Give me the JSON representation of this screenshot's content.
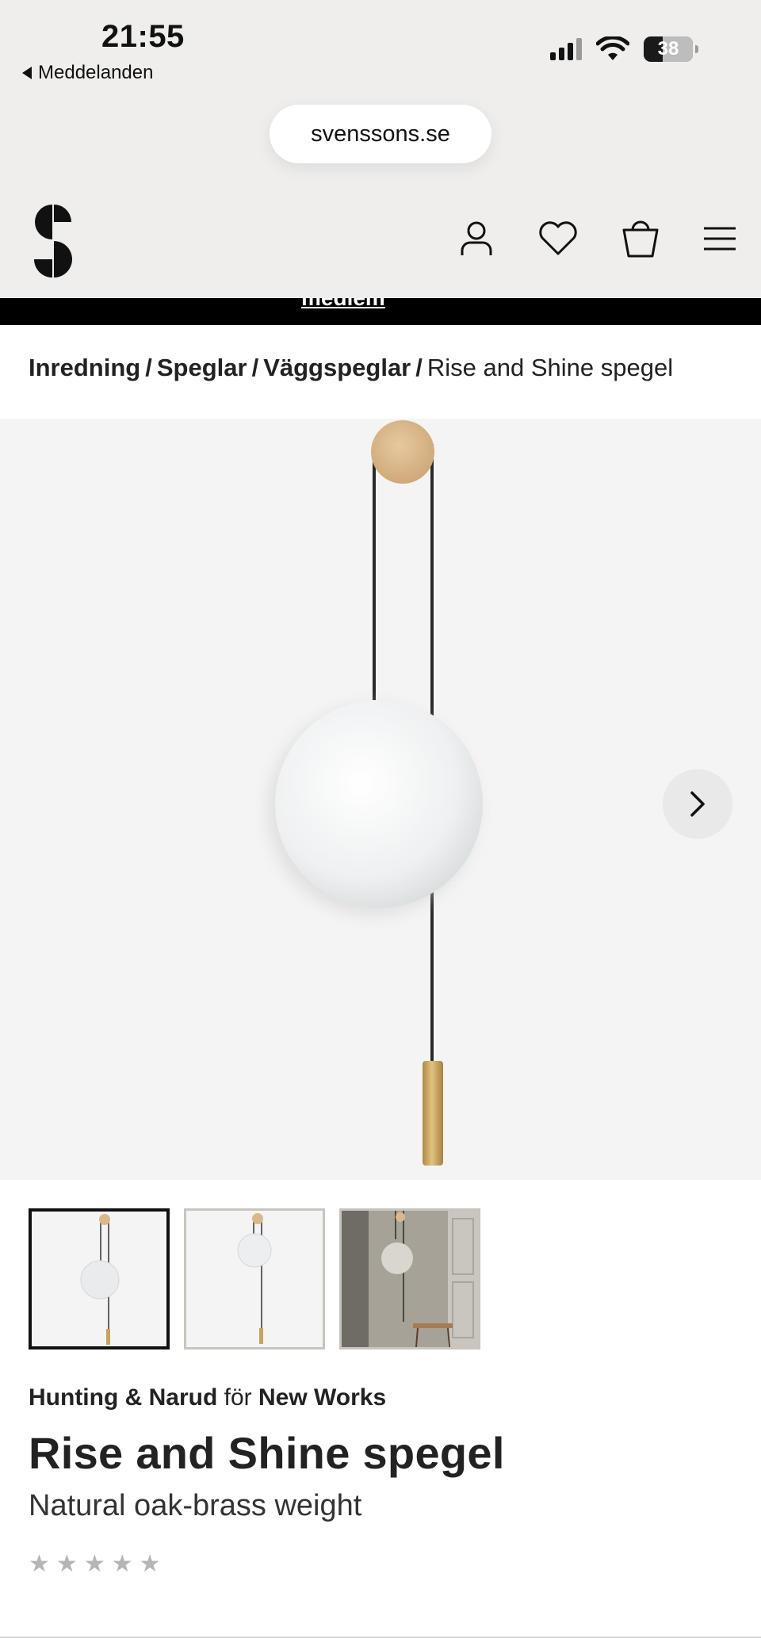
{
  "status_bar": {
    "time": "21:55",
    "back_label": "Meddelanden",
    "battery": "38",
    "battery_level": 0.38
  },
  "browser": {
    "url": "svenssons.se"
  },
  "header": {
    "logo_icon": "svenssons-s-logo",
    "icons": [
      "account-icon",
      "heart-icon",
      "basket-icon",
      "menu-icon"
    ],
    "promo_link": "medlem"
  },
  "breadcrumb": {
    "items": [
      "Inredning",
      "Speglar",
      "Väggspeglar"
    ],
    "separator": "/",
    "current": "Rise and Shine spegel"
  },
  "gallery": {
    "next_icon": "chevron-right-icon",
    "thumbnail_count": 3,
    "active_index": 0
  },
  "product": {
    "designer": "Hunting & Narud",
    "for_word": "för",
    "brand": "New Works",
    "title": "Rise and Shine spegel",
    "variant": "Natural oak-brass weight",
    "rating": {
      "stars": 5,
      "filled": 0
    }
  },
  "colors": {
    "header_bg": "#efeeec",
    "image_bg": "#f4f4f4",
    "oak": "#d9b98c",
    "brass": "#c8a25e"
  }
}
